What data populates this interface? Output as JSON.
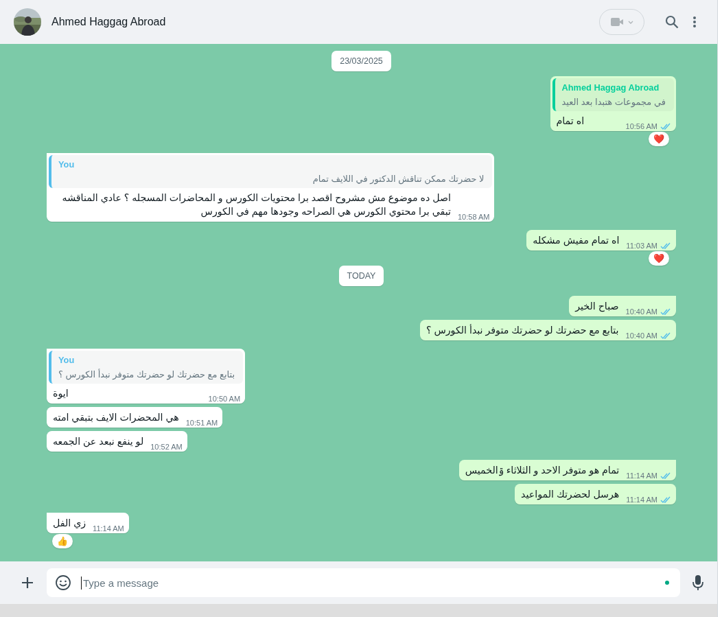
{
  "header": {
    "contact_name": "Ahmed Haggag Abroad"
  },
  "messages": [
    {
      "kind": "date",
      "text": "23/03/2025"
    },
    {
      "kind": "message",
      "outgoing": true,
      "tail": false,
      "quote": {
        "sender": "Ahmed Haggag Abroad",
        "text": "في مجموعات هتبدا بعد العيد"
      },
      "text": "اه تمام",
      "time": "10:56 AM",
      "read": true,
      "reaction": "❤️"
    },
    {
      "kind": "message",
      "outgoing": false,
      "tail": true,
      "quote": {
        "sender": "You",
        "text": "لا حضرتك ممكن تناقش الدكتور في اللايف تمام"
      },
      "text": "اصل ده موضوع مش مشروح اقصد برا محتويات الكورس و المحاضرات المسجله ؟ عادي المناقشه تبقي برا محتوي الكورس هي الصراحه وجودها مهم في الكورس",
      "time": "10:58 AM"
    },
    {
      "kind": "message",
      "outgoing": true,
      "tail": true,
      "text": "اه تمام مفيش مشكله",
      "time": "11:03 AM",
      "read": true,
      "reaction": "❤️"
    },
    {
      "kind": "date",
      "text": "TODAY"
    },
    {
      "kind": "message",
      "outgoing": true,
      "tail": true,
      "text": "صباح الخير",
      "time": "10:40 AM",
      "read": true
    },
    {
      "kind": "message",
      "outgoing": true,
      "tail": false,
      "text": "بتابع مع حضرتك لو حضرتك متوفر نبدأ الكورس ؟",
      "time": "10:40 AM",
      "read": true
    },
    {
      "kind": "message",
      "outgoing": false,
      "tail": true,
      "quote": {
        "sender": "You",
        "text": "بتابع مع حضرتك لو حضرتك متوفر نبدأ الكورس ؟"
      },
      "text": "ايوة",
      "time": "10:50 AM"
    },
    {
      "kind": "message",
      "outgoing": false,
      "tail": false,
      "text": "هي المحضرات الايف بتبقي امته",
      "time": "10:51 AM"
    },
    {
      "kind": "message",
      "outgoing": false,
      "tail": false,
      "text": "لو ينفع نبعد عن الجمعه",
      "time": "10:52 AM"
    },
    {
      "kind": "message",
      "outgoing": true,
      "tail": true,
      "text": "تمام هو متوفر الاحد و الثلاثاء ۊالخميس",
      "time": "11:14 AM",
      "read": true
    },
    {
      "kind": "message",
      "outgoing": true,
      "tail": false,
      "text": "هرسل لحضرتك المواعيد",
      "time": "11:14 AM",
      "read": true
    },
    {
      "kind": "message",
      "outgoing": false,
      "tail": true,
      "text": "زي الفل",
      "time": "11:14 AM",
      "reaction": "👍"
    }
  ],
  "composer": {
    "placeholder": "Type a message"
  }
}
